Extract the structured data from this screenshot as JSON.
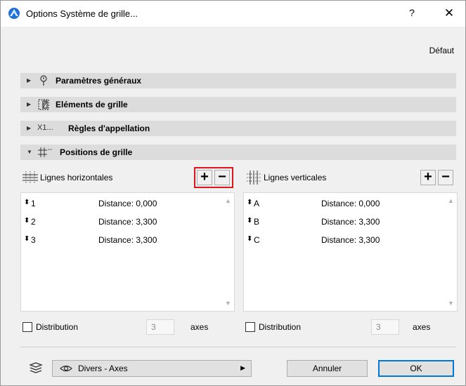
{
  "window": {
    "title": "Options Système de grille...",
    "help": "?",
    "close": "✕"
  },
  "default_label": "Défaut",
  "sections": [
    {
      "label": "Paramètres généraux",
      "icon": "general-settings-icon",
      "expanded": false
    },
    {
      "label": "Eléments de grille",
      "icon": "grid-elements-icon",
      "expanded": false
    },
    {
      "label": "Règles d'appellation",
      "icon_text": "X1...",
      "icon": "naming-rules-icon",
      "expanded": false
    },
    {
      "label": "Positions de grille",
      "icon": "grid-positions-icon",
      "expanded": true
    }
  ],
  "horizontal": {
    "label": "Lignes horizontales",
    "add": "+",
    "remove": "−",
    "rows": [
      {
        "name": "1",
        "distance": "Distance: 0,000"
      },
      {
        "name": "2",
        "distance": "Distance: 3,300"
      },
      {
        "name": "3",
        "distance": "Distance: 3,300"
      }
    ],
    "distribution_label": "Distribution",
    "axes_value": "3",
    "axes_label": "axes"
  },
  "vertical": {
    "label": "Lignes verticales",
    "add": "+",
    "remove": "−",
    "rows": [
      {
        "name": "A",
        "distance": "Distance: 0,000"
      },
      {
        "name": "B",
        "distance": "Distance: 3,300"
      },
      {
        "name": "C",
        "distance": "Distance: 3,300"
      }
    ],
    "distribution_label": "Distribution",
    "axes_value": "3",
    "axes_label": "axes"
  },
  "footer": {
    "layer_value": "Divers - Axes",
    "cancel": "Annuler",
    "ok": "OK"
  },
  "colors": {
    "highlight": "#e0141e",
    "ok_border": "#0078d7",
    "app_icon": "#1e6fd9"
  }
}
